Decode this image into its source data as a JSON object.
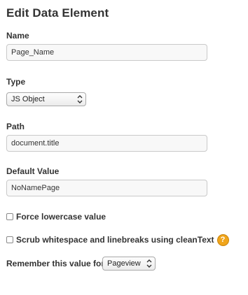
{
  "header": {
    "title": "Edit Data Element"
  },
  "form": {
    "name": {
      "label": "Name",
      "value": "Page_Name"
    },
    "type": {
      "label": "Type",
      "selected": "JS Object"
    },
    "path": {
      "label": "Path",
      "value": "document.title"
    },
    "default_value": {
      "label": "Default Value",
      "value": "NoNamePage"
    },
    "force_lowercase": {
      "label": "Force lowercase value",
      "checked": false
    },
    "scrub_whitespace": {
      "label": "Scrub whitespace and linebreaks using cleanText",
      "checked": false,
      "help_icon": "question-mark",
      "help_icon_color": "#f0a51b",
      "help_glyph": "?"
    },
    "remember": {
      "label": "Remember this value for",
      "selected": "Pageview"
    }
  }
}
